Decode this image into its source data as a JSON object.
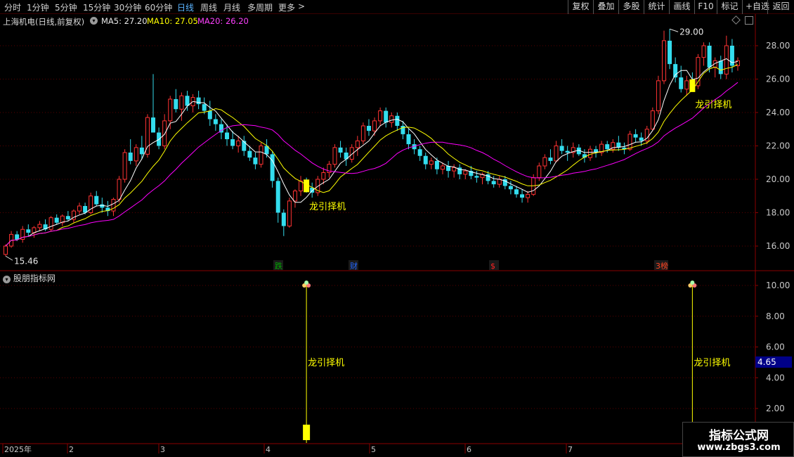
{
  "toolbar": {
    "periods": [
      "分时",
      "1分钟",
      "5分钟",
      "15分钟",
      "30分钟",
      "60分钟",
      "日线",
      "周线",
      "月线",
      "多周期",
      "更多"
    ],
    "more_arrow": ">",
    "buttons": [
      "复权",
      "叠加",
      "多股",
      "统计",
      "画线",
      "F10",
      "标记",
      "+自选",
      "返回"
    ]
  },
  "header": {
    "stock": "上海机电(日线,前复权)",
    "ma5": "MA5: 27.20",
    "ma10": "MA10: 27.05",
    "ma20": "MA20: 26.20"
  },
  "colors": {
    "up": "#ff3333",
    "down": "#33ddee",
    "ma5": "#ffffff",
    "ma10": "#ffff00",
    "ma20": "#ff00ff",
    "grid": "#5a0000",
    "axis": "#c8c8c8",
    "signal": "#ffff00"
  },
  "main_axis": {
    "labels": [
      "28.00",
      "26.00",
      "24.00",
      "22.00",
      "20.00",
      "18.00",
      "16.00"
    ]
  },
  "sub_axis": {
    "labels": [
      "10.00",
      "8.00",
      "6.00",
      "4.00",
      "2.00"
    ]
  },
  "annotations": {
    "high": "29.00",
    "low": "15.46",
    "signal_text": "龙引择机"
  },
  "event_tags": [
    "跌",
    "财",
    "$",
    "3榜"
  ],
  "sub_panel": {
    "title": "股朋指标网",
    "current_value": "4.65"
  },
  "date_axis": {
    "labels": [
      "2025年",
      "2",
      "3",
      "4",
      "5",
      "6",
      "7"
    ]
  },
  "watermark": {
    "title": "指标公式网",
    "url": "www.zbgs3.com"
  },
  "chart_data": {
    "type": "candlestick",
    "title": "上海机电(日线,前复权)",
    "ylim": [
      15,
      29.5
    ],
    "candles": [
      [
        15.5,
        16.1,
        15.4,
        16.0
      ],
      [
        16.0,
        16.9,
        15.9,
        16.7
      ],
      [
        16.7,
        16.9,
        16.3,
        16.4
      ],
      [
        16.4,
        17.2,
        16.2,
        17.0
      ],
      [
        17.0,
        17.3,
        16.6,
        16.8
      ],
      [
        16.8,
        17.2,
        16.5,
        17.1
      ],
      [
        17.1,
        17.5,
        16.9,
        17.3
      ],
      [
        17.3,
        17.6,
        16.9,
        17.0
      ],
      [
        17.0,
        17.8,
        16.9,
        17.7
      ],
      [
        17.7,
        17.9,
        17.3,
        17.4
      ],
      [
        17.4,
        17.9,
        17.2,
        17.8
      ],
      [
        17.8,
        18.1,
        17.5,
        17.6
      ],
      [
        17.6,
        18.2,
        17.4,
        18.1
      ],
      [
        18.1,
        18.6,
        17.9,
        18.4
      ],
      [
        18.4,
        18.6,
        17.9,
        18.0
      ],
      [
        18.0,
        19.2,
        17.9,
        19.0
      ],
      [
        19.0,
        19.3,
        18.4,
        18.5
      ],
      [
        18.5,
        18.9,
        18.0,
        18.3
      ],
      [
        18.3,
        18.7,
        17.8,
        18.1
      ],
      [
        18.1,
        18.9,
        17.8,
        18.8
      ],
      [
        18.8,
        20.2,
        18.6,
        20.0
      ],
      [
        20.0,
        21.8,
        19.8,
        21.6
      ],
      [
        21.6,
        22.4,
        20.9,
        21.1
      ],
      [
        21.1,
        22.1,
        20.8,
        21.9
      ],
      [
        21.9,
        22.6,
        21.2,
        21.5
      ],
      [
        21.5,
        23.9,
        21.3,
        23.7
      ],
      [
        23.7,
        26.3,
        23.0,
        22.8
      ],
      [
        22.8,
        23.1,
        21.8,
        22.0
      ],
      [
        22.0,
        23.9,
        21.8,
        23.5
      ],
      [
        23.5,
        25.0,
        23.0,
        24.8
      ],
      [
        24.8,
        25.4,
        24.0,
        24.2
      ],
      [
        24.2,
        25.2,
        23.5,
        25.0
      ],
      [
        25.0,
        25.3,
        24.1,
        24.4
      ],
      [
        24.4,
        25.1,
        24.0,
        24.9
      ],
      [
        24.9,
        25.3,
        24.2,
        24.5
      ],
      [
        24.5,
        24.9,
        23.9,
        24.1
      ],
      [
        24.1,
        24.7,
        23.2,
        23.6
      ],
      [
        23.6,
        23.9,
        22.9,
        23.3
      ],
      [
        23.3,
        23.6,
        22.4,
        22.8
      ],
      [
        22.8,
        23.3,
        22.0,
        22.4
      ],
      [
        22.4,
        22.9,
        21.8,
        22.0
      ],
      [
        22.0,
        22.6,
        21.6,
        22.3
      ],
      [
        22.3,
        22.6,
        21.4,
        21.7
      ],
      [
        21.7,
        22.0,
        21.1,
        21.3
      ],
      [
        21.3,
        21.6,
        20.6,
        20.9
      ],
      [
        20.9,
        22.2,
        20.7,
        22.0
      ],
      [
        22.0,
        22.4,
        21.3,
        21.5
      ],
      [
        21.5,
        21.7,
        19.5,
        19.9
      ],
      [
        19.9,
        20.1,
        17.4,
        18.0
      ],
      [
        18.0,
        18.2,
        16.6,
        17.2
      ],
      [
        17.2,
        18.9,
        17.1,
        18.7
      ],
      [
        18.7,
        19.4,
        18.3,
        19.3
      ],
      [
        19.3,
        20.2,
        19.0,
        19.9
      ],
      [
        19.9,
        20.1,
        19.2,
        19.5
      ],
      [
        19.5,
        19.8,
        18.9,
        19.2
      ],
      [
        19.2,
        20.2,
        19.0,
        20.0
      ],
      [
        20.0,
        20.7,
        19.7,
        20.4
      ],
      [
        20.4,
        21.1,
        20.1,
        20.9
      ],
      [
        20.9,
        22.1,
        20.7,
        21.9
      ],
      [
        21.9,
        22.3,
        21.3,
        21.6
      ],
      [
        21.6,
        21.9,
        20.8,
        21.2
      ],
      [
        21.2,
        22.1,
        21.0,
        21.9
      ],
      [
        21.9,
        22.6,
        21.4,
        22.3
      ],
      [
        22.3,
        23.4,
        22.1,
        23.2
      ],
      [
        23.2,
        23.6,
        22.6,
        22.9
      ],
      [
        22.9,
        23.7,
        22.6,
        23.5
      ],
      [
        23.5,
        24.3,
        23.2,
        24.1
      ],
      [
        24.1,
        24.3,
        23.1,
        23.4
      ],
      [
        23.4,
        24.0,
        23.1,
        23.8
      ],
      [
        23.8,
        24.0,
        22.9,
        23.2
      ],
      [
        23.2,
        23.5,
        22.4,
        22.7
      ],
      [
        22.7,
        23.0,
        21.8,
        22.1
      ],
      [
        22.1,
        22.4,
        21.5,
        21.8
      ],
      [
        21.8,
        22.0,
        21.1,
        21.4
      ],
      [
        21.4,
        21.6,
        20.6,
        20.9
      ],
      [
        20.9,
        21.3,
        20.6,
        21.1
      ],
      [
        21.1,
        21.3,
        20.3,
        20.6
      ],
      [
        20.6,
        21.0,
        20.3,
        20.8
      ],
      [
        20.8,
        21.1,
        20.1,
        20.5
      ],
      [
        20.5,
        20.9,
        20.1,
        20.7
      ],
      [
        20.7,
        20.9,
        20.0,
        20.3
      ],
      [
        20.3,
        20.6,
        20.0,
        20.5
      ],
      [
        20.5,
        20.8,
        20.0,
        20.2
      ],
      [
        20.2,
        20.5,
        19.8,
        20.1
      ],
      [
        20.1,
        20.4,
        19.7,
        20.3
      ],
      [
        20.3,
        20.5,
        19.7,
        19.9
      ],
      [
        19.9,
        20.2,
        19.5,
        19.7
      ],
      [
        19.7,
        20.2,
        19.5,
        20.0
      ],
      [
        20.0,
        20.2,
        19.4,
        19.6
      ],
      [
        19.6,
        19.9,
        19.1,
        19.4
      ],
      [
        19.4,
        19.6,
        18.9,
        19.1
      ],
      [
        19.1,
        19.4,
        18.6,
        18.9
      ],
      [
        18.9,
        19.3,
        18.6,
        19.1
      ],
      [
        19.1,
        20.3,
        19.0,
        20.1
      ],
      [
        20.1,
        21.0,
        19.9,
        20.8
      ],
      [
        20.8,
        21.5,
        20.6,
        21.3
      ],
      [
        21.3,
        21.8,
        20.9,
        21.1
      ],
      [
        21.1,
        22.3,
        21.0,
        22.0
      ],
      [
        22.0,
        22.4,
        21.5,
        21.7
      ],
      [
        21.7,
        22.0,
        21.1,
        21.6
      ],
      [
        21.6,
        22.2,
        21.3,
        21.9
      ],
      [
        21.9,
        22.1,
        21.4,
        21.5
      ],
      [
        21.5,
        21.8,
        21.0,
        21.3
      ],
      [
        21.3,
        22.0,
        21.1,
        21.8
      ],
      [
        21.8,
        22.0,
        21.3,
        21.6
      ],
      [
        21.6,
        22.3,
        21.4,
        22.1
      ],
      [
        22.1,
        22.3,
        21.6,
        21.8
      ],
      [
        21.8,
        22.4,
        21.6,
        22.2
      ],
      [
        22.2,
        22.6,
        21.7,
        21.9
      ],
      [
        21.9,
        22.2,
        21.5,
        21.8
      ],
      [
        21.8,
        22.9,
        21.7,
        22.7
      ],
      [
        22.7,
        23.0,
        22.2,
        22.5
      ],
      [
        22.5,
        22.8,
        22.0,
        22.3
      ],
      [
        22.3,
        23.2,
        22.1,
        23.0
      ],
      [
        23.0,
        24.3,
        22.9,
        24.1
      ],
      [
        24.1,
        26.2,
        23.9,
        25.9
      ],
      [
        25.9,
        28.9,
        25.7,
        28.3
      ],
      [
        28.3,
        29.0,
        26.6,
        26.9
      ],
      [
        26.9,
        27.3,
        25.8,
        26.1
      ],
      [
        26.1,
        26.8,
        25.2,
        25.4
      ],
      [
        25.4,
        26.2,
        25.0,
        25.9
      ],
      [
        25.9,
        26.4,
        25.3,
        25.6
      ],
      [
        25.6,
        27.5,
        25.4,
        27.3
      ],
      [
        27.3,
        28.2,
        26.8,
        28.0
      ],
      [
        28.0,
        28.2,
        26.4,
        26.7
      ],
      [
        26.7,
        27.3,
        26.1,
        27.1
      ],
      [
        27.1,
        27.4,
        26.0,
        26.3
      ],
      [
        26.3,
        28.6,
        26.0,
        28.0
      ],
      [
        28.0,
        28.4,
        26.4,
        26.8
      ],
      [
        26.8,
        27.3,
        26.5,
        27.1
      ]
    ],
    "signals_at": [
      53,
      121
    ],
    "signal_values": [
      10,
      10
    ],
    "sub_ylim": [
      0,
      11
    ]
  }
}
